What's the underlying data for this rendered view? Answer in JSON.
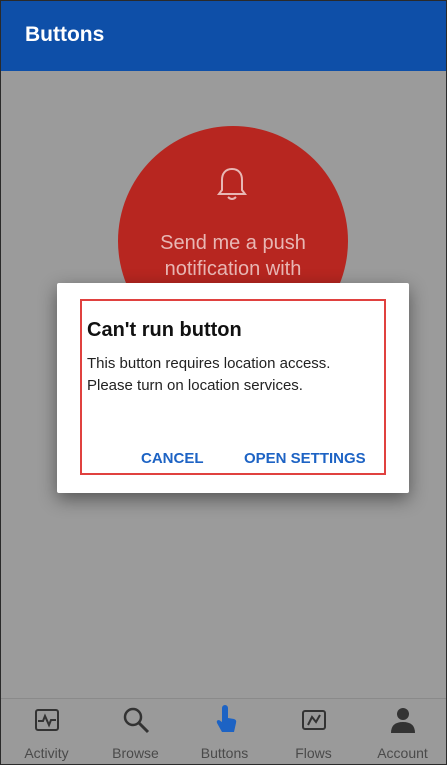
{
  "header": {
    "title": "Buttons"
  },
  "flow_button": {
    "text_line1": "Send me a push",
    "text_line2": "notification with",
    "icon": "bell-icon",
    "color": "#b72620"
  },
  "dialog": {
    "title": "Can't run button",
    "message_line1": "This button requires location access.",
    "message_line2": "Please turn on location services.",
    "cancel_label": "CANCEL",
    "open_settings_label": "OPEN SETTINGS",
    "highlight_color": "#e0413f"
  },
  "tabbar": {
    "items": [
      {
        "label": "Activity",
        "icon": "activity-icon",
        "selected": false
      },
      {
        "label": "Browse",
        "icon": "search-icon",
        "selected": false
      },
      {
        "label": "Buttons",
        "icon": "touch-icon",
        "selected": true
      },
      {
        "label": "Flows",
        "icon": "flows-icon",
        "selected": false
      },
      {
        "label": "Account",
        "icon": "person-icon",
        "selected": false
      }
    ]
  },
  "colors": {
    "header": "#0e4fa8",
    "accent": "#1d63c4"
  }
}
